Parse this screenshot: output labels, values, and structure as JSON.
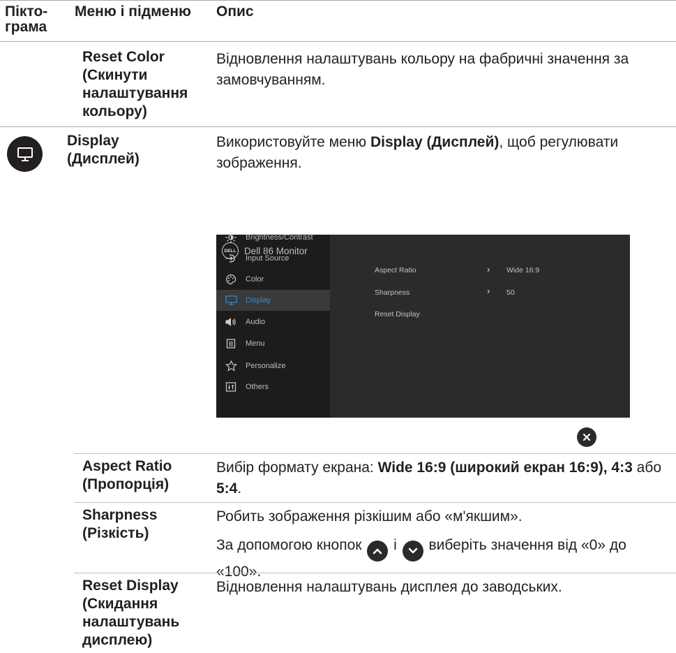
{
  "header": {
    "col1": "Пікто-\nграма",
    "col2": "Меню і підменю",
    "col3": "Опис"
  },
  "rows": {
    "reset_color": {
      "name": "Reset Color\n(Скинути\nналаштування\nкольору)",
      "desc": "Відновлення налаштувань кольору на фабричні значення за замовчуванням."
    },
    "display": {
      "icon": "monitor-icon",
      "name": "Display\n(Дисплей)",
      "desc_pre": "Використовуйте меню ",
      "desc_bold": "Display (Дисплей)",
      "desc_post": ", щоб регулювати зображення."
    },
    "aspect_ratio": {
      "name": "Aspect Ratio\n(Пропорція)",
      "desc_pre": "Вибір формату екрана: ",
      "desc_bold1": "Wide 16:9 (широкий екран 16:9), 4:3",
      "desc_mid": " або ",
      "desc_bold2": "5:4",
      "desc_post": "."
    },
    "sharpness": {
      "name": "Sharpness\n(Різкість)",
      "desc1": "Робить зображення різкішим або «м'якшим».",
      "desc2_pre": "За допомогою кнопок ",
      "desc2_mid": " і ",
      "desc2_post": " виберіть значення від «0» до «100».",
      "up_icon": "chevron-up-circle-icon",
      "down_icon": "chevron-down-circle-icon"
    },
    "reset_display": {
      "name": "Reset Display\n(Скидання\nналаштувань\nдисплею)",
      "desc": "Відновлення налаштувань дисплея до заводських."
    }
  },
  "osd": {
    "logo": "DELL",
    "title": "Dell 86 Monitor",
    "menu": [
      {
        "label": "Brightness/Contrast",
        "icon": "brightness-icon",
        "active": false
      },
      {
        "label": "Input Source",
        "icon": "input-source-icon",
        "active": false
      },
      {
        "label": "Color",
        "icon": "color-palette-icon",
        "active": false
      },
      {
        "label": "Display",
        "icon": "monitor-icon",
        "active": true
      },
      {
        "label": "Audio",
        "icon": "speaker-icon",
        "active": false
      },
      {
        "label": "Menu",
        "icon": "menu-icon",
        "active": false
      },
      {
        "label": "Personalize",
        "icon": "star-icon",
        "active": false
      },
      {
        "label": "Others",
        "icon": "others-icon",
        "active": false
      }
    ],
    "options": [
      {
        "label": "Aspect Ratio",
        "value": "Wide 16:9"
      },
      {
        "label": "Sharpness",
        "value": "50"
      },
      {
        "label": "Reset Display",
        "value": ""
      }
    ],
    "active_color": "#2d8dd6",
    "close_icon": "close-icon"
  }
}
